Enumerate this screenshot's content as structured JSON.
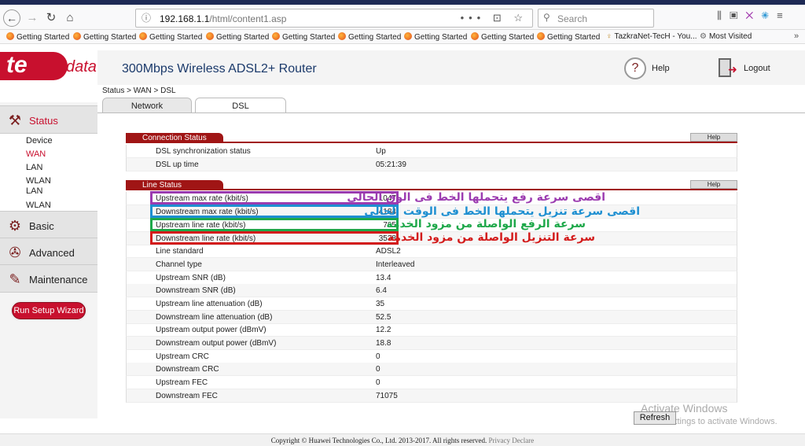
{
  "browser": {
    "url_host": "192.168.1.1",
    "url_path": "/html/content1.asp",
    "page_actions": "••• ⊡ ☆",
    "search_placeholder": "Search",
    "bookmarks": [
      "Getting Started",
      "Getting Started",
      "Getting Started",
      "Getting Started",
      "Getting Started",
      "Getting Started",
      "Getting Started",
      "Getting Started",
      "Getting Started",
      "TazkraNet-TecH - You...",
      "Most Visited"
    ]
  },
  "brand": {
    "logo_main": "te",
    "logo_sub": "data"
  },
  "header": {
    "title": "300Mbps Wireless ADSL2+ Router",
    "help": "Help",
    "logout": "Logout"
  },
  "breadcrumb": "Status > WAN > DSL",
  "tabs": [
    "Network",
    "DSL"
  ],
  "sidebar": {
    "status": "Status",
    "status_items": [
      "Device",
      "WAN",
      "LAN",
      "WLAN",
      "LAN",
      "WLAN"
    ],
    "basic": "Basic",
    "advanced": "Advanced",
    "maintenance": "Maintenance",
    "wizard": "Run Setup Wizard"
  },
  "connection_status": {
    "title": "Connection Status",
    "help": "Help",
    "rows": [
      {
        "k": "DSL synchronization status",
        "v": "Up"
      },
      {
        "k": "DSL up time",
        "v": "05:21:39"
      }
    ]
  },
  "line_status": {
    "title": "Line Status",
    "help": "Help",
    "rows": [
      {
        "k": "Upstream max rate (kbit/s)",
        "v": "1047"
      },
      {
        "k": "Downstream max rate (kbit/s)",
        "v": "4184"
      },
      {
        "k": "Upstream line rate (kbit/s)",
        "v": "765"
      },
      {
        "k": "Downstream line rate (kbit/s)",
        "v": "3538"
      },
      {
        "k": "Line standard",
        "v": "ADSL2"
      },
      {
        "k": "Channel type",
        "v": "Interleaved"
      },
      {
        "k": "Upstream SNR (dB)",
        "v": "13.4"
      },
      {
        "k": "Downstream SNR (dB)",
        "v": "6.4"
      },
      {
        "k": "Upstream line attenuation (dB)",
        "v": "35"
      },
      {
        "k": "Downstream line attenuation (dB)",
        "v": "52.5"
      },
      {
        "k": "Upstream output power (dBmV)",
        "v": "12.2"
      },
      {
        "k": "Downstream output power (dBmV)",
        "v": "18.8"
      },
      {
        "k": "Upstream CRC",
        "v": "0"
      },
      {
        "k": "Downstream CRC",
        "v": "0"
      },
      {
        "k": "Upstream FEC",
        "v": "0"
      },
      {
        "k": "Downstream FEC",
        "v": "71075"
      }
    ]
  },
  "annotations": [
    "اقصى سرعة رفع يتحملها الخط فى الوق الحالى",
    "اقصى سرعة تنزيل يتحملها الخط فى الوقت الحالى",
    "سرعة الرفع الواصلة من مزود الخدمة",
    "سرعة التنزيل الواصلة من مزود الخدمة"
  ],
  "refresh": "Refresh",
  "windows_watermark": {
    "line1": "Activate Windows",
    "line2": "Go to Settings to activate Windows."
  },
  "footer": {
    "copyright": "Copyright © Huawei Technologies Co., Ltd. 2013-2017. All rights reserved.",
    "privacy": "Privacy Declare"
  }
}
